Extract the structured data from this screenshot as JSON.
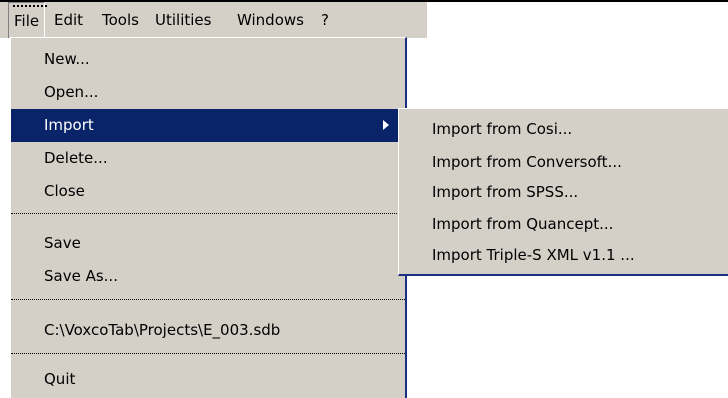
{
  "menubar": {
    "items": [
      "File",
      "Edit",
      "Tools",
      "Utilities",
      "Windows",
      "?"
    ]
  },
  "file_menu": {
    "items": [
      "New...",
      "Open...",
      "Import",
      "Delete...",
      "Close",
      "Save",
      "Save As...",
      "C:\\VoxcoTab\\Projects\\E_003.sdb",
      "Quit"
    ]
  },
  "import_submenu": {
    "items": [
      "Import from Cosi...",
      "Import from Conversoft...",
      "Import from SPSS...",
      "Import from Quancept...",
      "Import Triple-S XML v1.1 ..."
    ]
  },
  "colors": {
    "menu_bg": "#d4d0c8",
    "highlight": "#0a246a",
    "border_accent": "#1a2f80"
  }
}
